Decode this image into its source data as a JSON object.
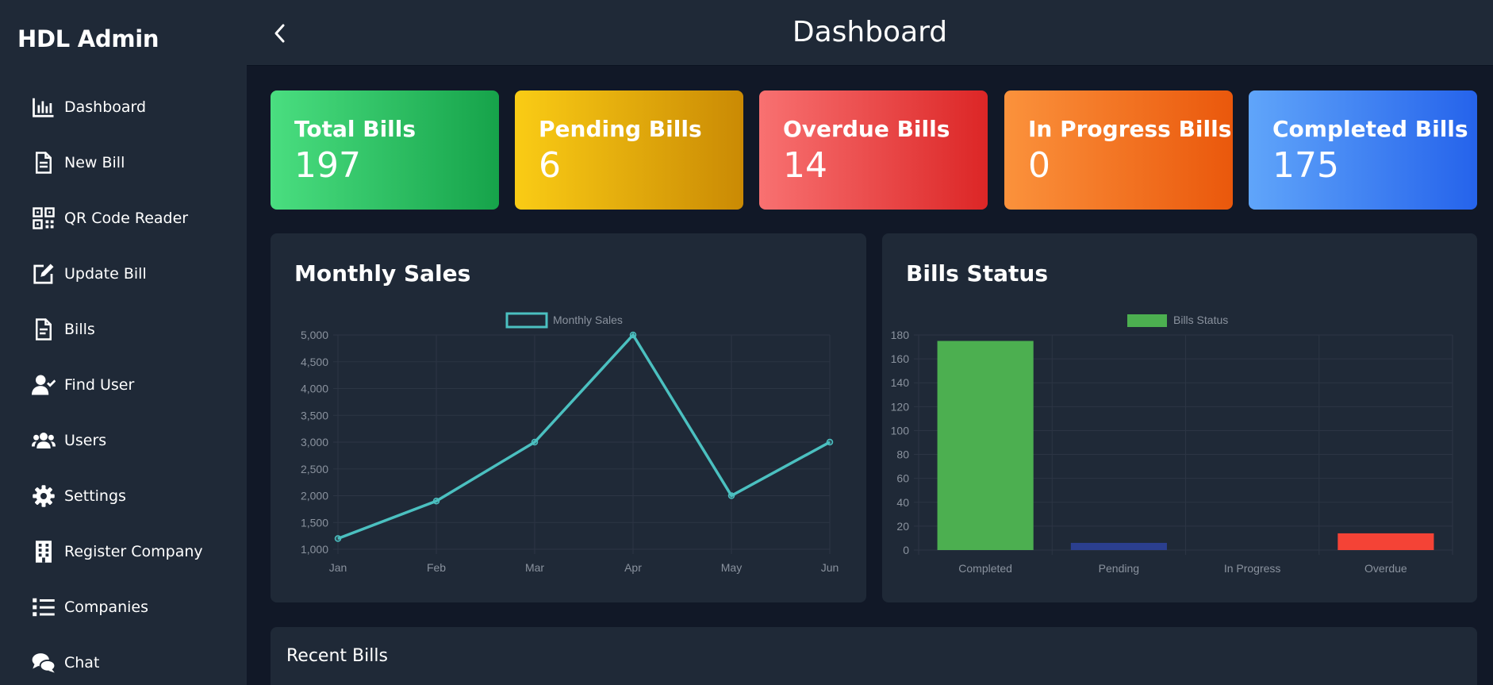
{
  "app": {
    "brand": "HDL Admin",
    "page_title": "Dashboard"
  },
  "sidebar": {
    "items": [
      {
        "label": "Dashboard",
        "icon": "chart-bar-icon"
      },
      {
        "label": "New Bill",
        "icon": "file-icon"
      },
      {
        "label": "QR Code Reader",
        "icon": "qrcode-icon"
      },
      {
        "label": "Update Bill",
        "icon": "edit-icon"
      },
      {
        "label": "Bills",
        "icon": "file-alt-icon"
      },
      {
        "label": "Find User",
        "icon": "user-check-icon"
      },
      {
        "label": "Users",
        "icon": "users-icon"
      },
      {
        "label": "Settings",
        "icon": "gear-icon"
      },
      {
        "label": "Register Company",
        "icon": "building-icon"
      },
      {
        "label": "Companies",
        "icon": "list-icon"
      },
      {
        "label": "Chat",
        "icon": "comments-icon"
      }
    ]
  },
  "stats": [
    {
      "label": "Total Bills",
      "value": "197",
      "colors": [
        "#4ade80",
        "#16a34a"
      ]
    },
    {
      "label": "Pending Bills",
      "value": "6",
      "colors": [
        "#facc15",
        "#ca8a04"
      ]
    },
    {
      "label": "Overdue Bills",
      "value": "14",
      "colors": [
        "#f87171",
        "#dc2626"
      ]
    },
    {
      "label": "In Progress Bills",
      "value": "0",
      "colors": [
        "#fb923c",
        "#ea580c"
      ]
    },
    {
      "label": "Completed Bills",
      "value": "175",
      "colors": [
        "#60a5fa",
        "#2563eb"
      ]
    }
  ],
  "panels": {
    "monthly_title": "Monthly Sales",
    "status_title": "Bills Status"
  },
  "recent": {
    "title": "Recent Bills"
  },
  "chart_data": [
    {
      "type": "line",
      "title": "Monthly Sales",
      "categories": [
        "Jan",
        "Feb",
        "Mar",
        "Apr",
        "May",
        "Jun"
      ],
      "series": [
        {
          "name": "Monthly Sales",
          "values": [
            1200,
            1900,
            3000,
            5000,
            2000,
            3000
          ],
          "color": "#4bc0c0"
        }
      ],
      "ylim": [
        1000,
        5000
      ],
      "yticks": [
        "1,000",
        "1,500",
        "2,000",
        "2,500",
        "3,000",
        "3,500",
        "4,000",
        "4,500",
        "5,000"
      ],
      "grid": true,
      "legend": "top-center"
    },
    {
      "type": "bar",
      "title": "Bills Status",
      "categories": [
        "Completed",
        "Pending",
        "In Progress",
        "Overdue"
      ],
      "series": [
        {
          "name": "Bills Status",
          "values": [
            175,
            6,
            0,
            14
          ]
        }
      ],
      "colors": [
        "#4caf50",
        "#2b3f8f",
        "#ff9800",
        "#f44336"
      ],
      "legend_color": "#4caf50",
      "ylim": [
        0,
        180
      ],
      "yticks": [
        "0",
        "20",
        "40",
        "60",
        "80",
        "100",
        "120",
        "140",
        "160",
        "180"
      ],
      "grid": true,
      "legend": "top-center"
    }
  ]
}
